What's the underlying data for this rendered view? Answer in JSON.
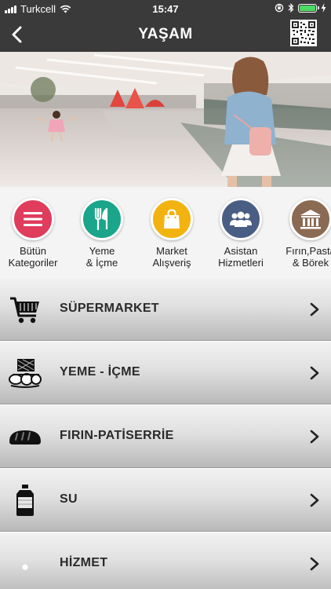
{
  "status_bar": {
    "carrier": "Turkcell",
    "time": "15:47",
    "colors": {
      "battery": "#4cd964"
    }
  },
  "header": {
    "title": "YAŞAM",
    "background": "#3a3a3a",
    "icons": [
      "back-chevron-icon",
      "qr-code-icon"
    ]
  },
  "categories": [
    {
      "label": "Bütün\nKategoriler",
      "icon": "menu-lines-icon",
      "color": "#e03c5c"
    },
    {
      "label": "Yeme\n& İçme",
      "icon": "fork-knife-icon",
      "color": "#1ba58a"
    },
    {
      "label": "Market\nAlışveriş",
      "icon": "shopping-bag-icon",
      "color": "#f2b311"
    },
    {
      "label": "Asistan\nHizmetleri",
      "icon": "people-icon",
      "color": "#4a5e84"
    },
    {
      "label": "Fırın,Pasta\n& Börek",
      "icon": "bakery-building-icon",
      "color": "#8a6a52"
    }
  ],
  "list": [
    {
      "label": "SÜPERMARKET",
      "icon": "shopping-cart-icon"
    },
    {
      "label": "YEME - İÇME",
      "icon": "food-basket-icon"
    },
    {
      "label": "FIRIN-PATİSERRİE",
      "icon": "bread-icon"
    },
    {
      "label": "SU",
      "icon": "water-bottle-icon"
    },
    {
      "label": "HİZMET",
      "icon": "service-icon"
    }
  ]
}
